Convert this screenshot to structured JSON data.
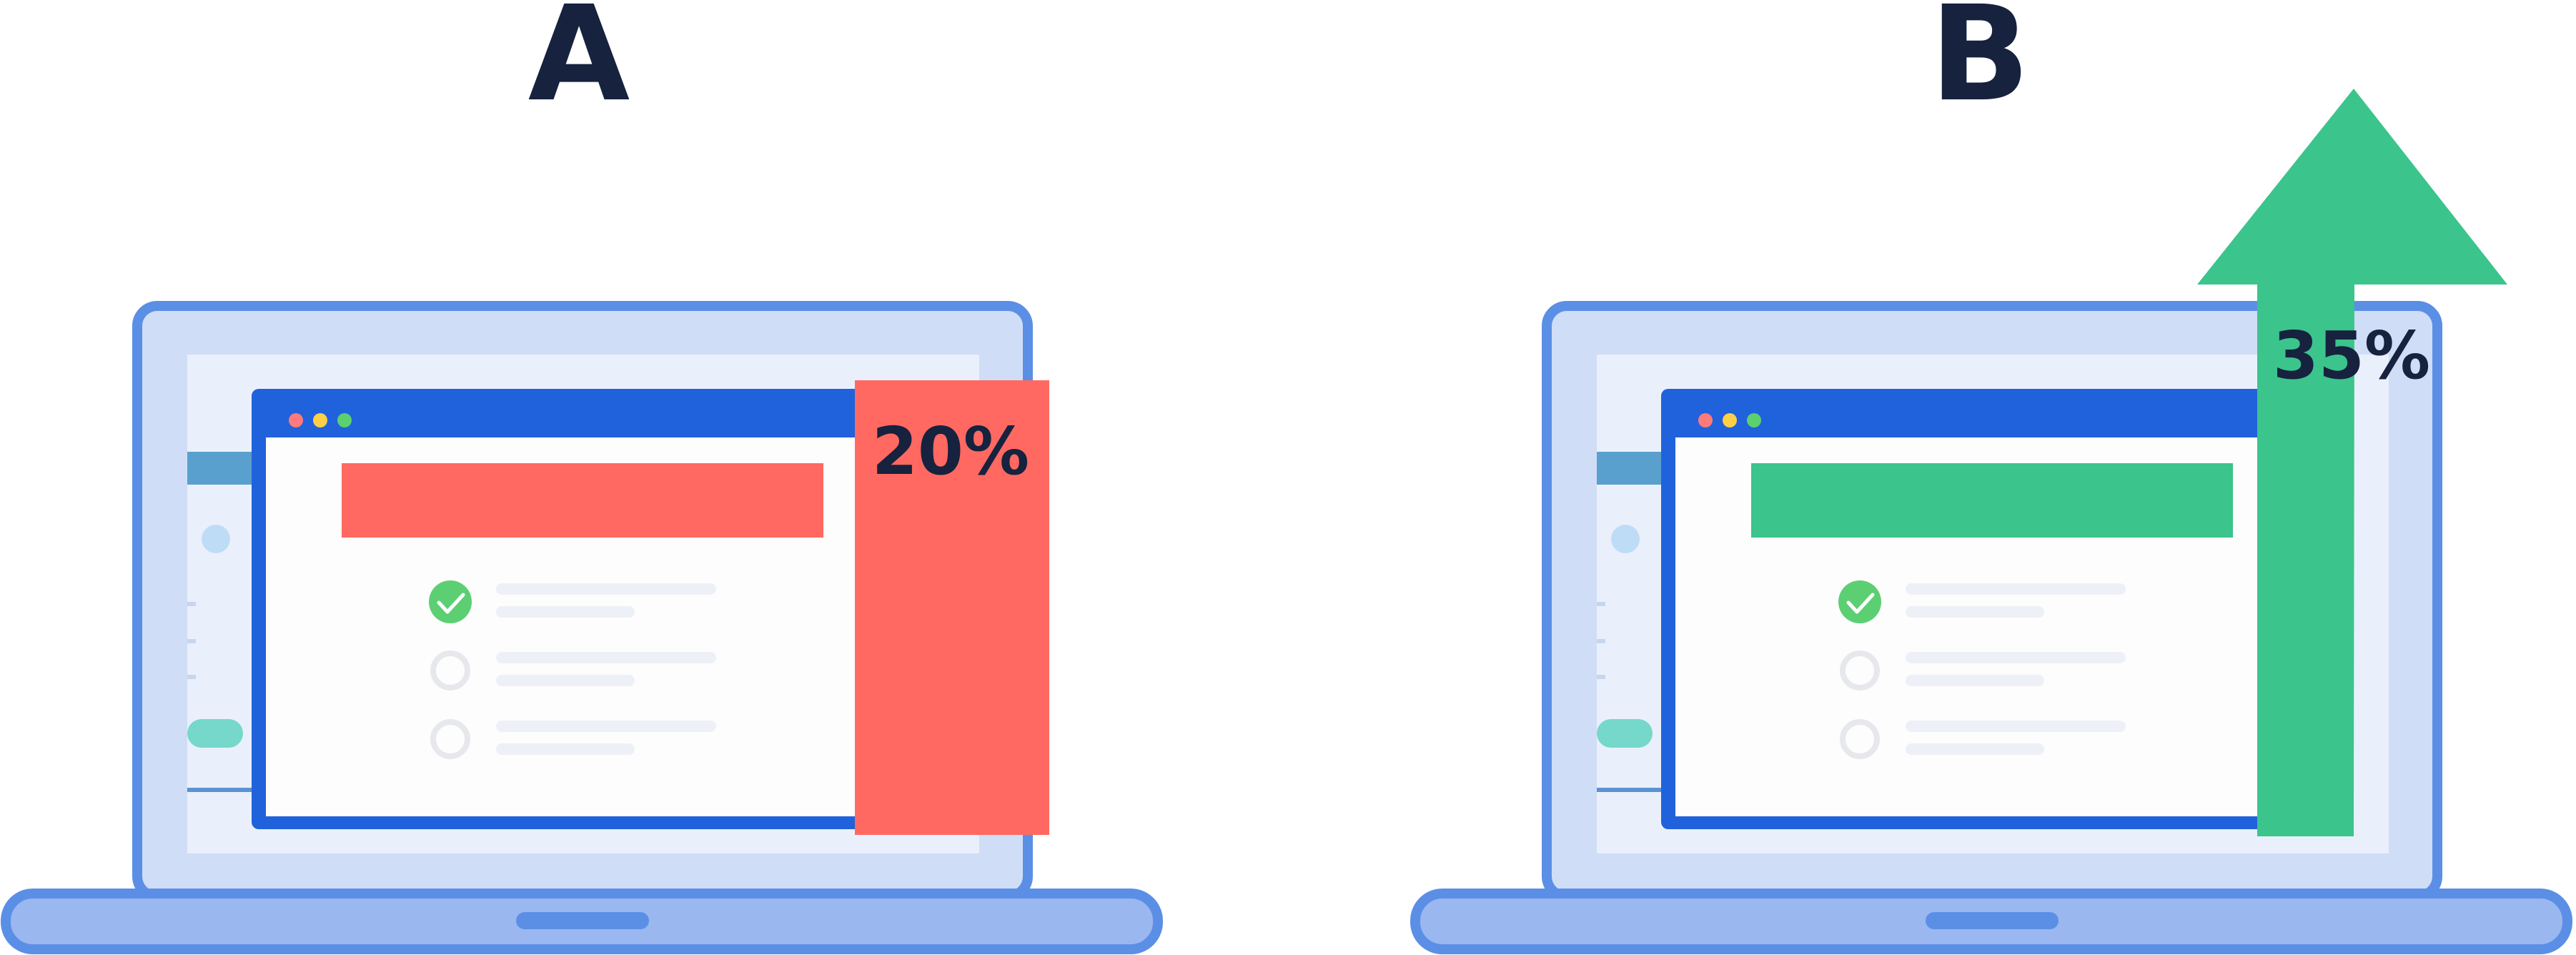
{
  "variants": [
    {
      "label": "A",
      "percent": "20%",
      "accent_color": "#ff6961"
    },
    {
      "label": "B",
      "percent": "35%",
      "accent_color": "#3bc48c"
    }
  ],
  "colors": {
    "laptop_frame": "#5b8fe6",
    "laptop_screen_bg": "#d0ddf7",
    "window_bar": "#2062dc",
    "check_green": "#5ccf73",
    "label_dark": "#16223e"
  },
  "icons": [
    "check-icon",
    "empty-circle-icon",
    "up-arrow-icon",
    "window-dot-icon"
  ]
}
